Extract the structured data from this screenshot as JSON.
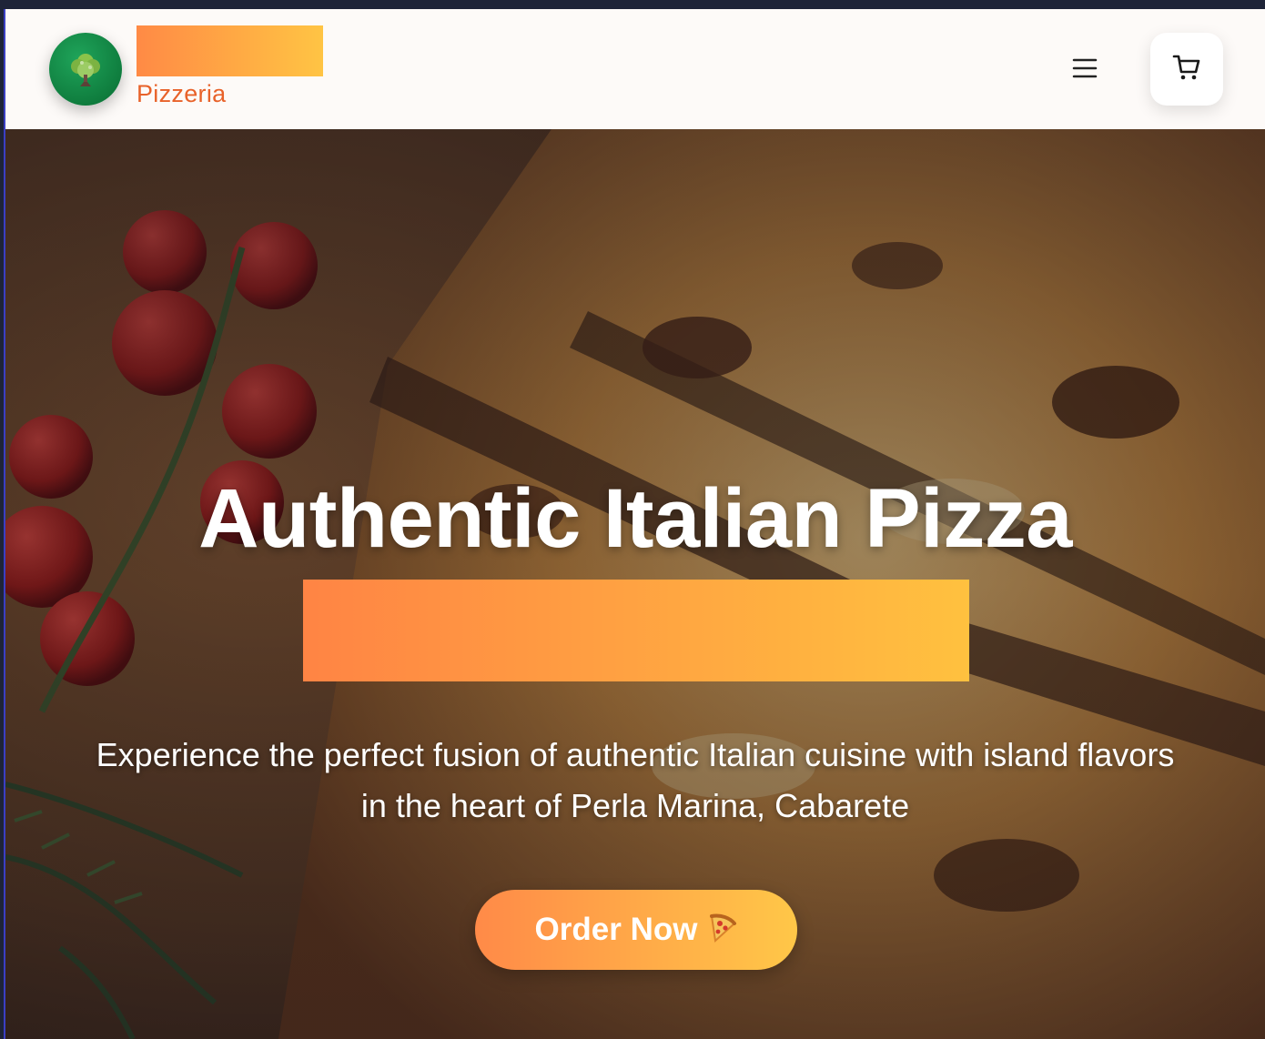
{
  "header": {
    "logo_icon": "tree-icon",
    "brand_subtitle": "Pizzeria",
    "menu_icon": "hamburger-menu-icon",
    "cart_icon": "shopping-cart-icon"
  },
  "hero": {
    "title": "Authentic Italian Pizza",
    "subtitle": "Experience the perfect fusion of authentic Italian cuisine with island flavors in the heart of Perla Marina, Cabarete",
    "cta_label": "Order Now",
    "cta_icon": "pizza-slice-icon",
    "background": "pizza-photo"
  },
  "colors": {
    "accent_start": "#ff8a45",
    "accent_end": "#ffc444",
    "brand_text": "#e8622a",
    "logo_green": "#0f7d3e"
  }
}
